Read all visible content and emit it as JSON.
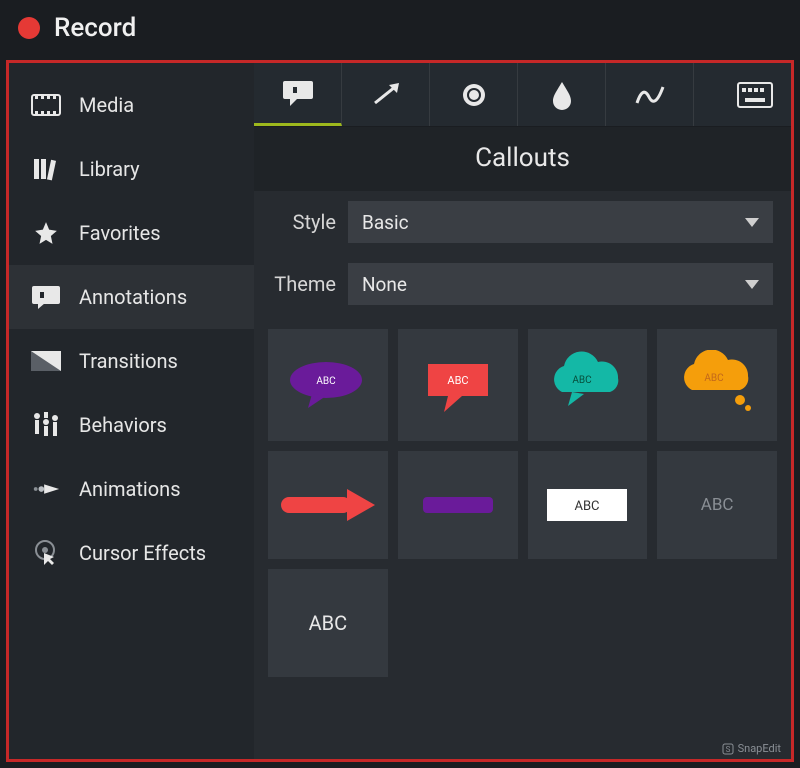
{
  "topbar": {
    "record_label": "Record"
  },
  "sidebar": {
    "items": [
      {
        "label": "Media"
      },
      {
        "label": "Library"
      },
      {
        "label": "Favorites"
      },
      {
        "label": "Annotations"
      },
      {
        "label": "Transitions"
      },
      {
        "label": "Behaviors"
      },
      {
        "label": "Animations"
      },
      {
        "label": "Cursor Effects"
      }
    ],
    "active_index": 3
  },
  "tabs": {
    "items": [
      "callout",
      "arrow",
      "shape",
      "blur",
      "sketch",
      "keyboard"
    ],
    "active_index": 0
  },
  "panel": {
    "title": "Callouts",
    "style_label": "Style",
    "style_value": "Basic",
    "theme_label": "Theme",
    "theme_value": "None"
  },
  "callout_tiles": [
    {
      "kind": "speech-oval",
      "color": "#6a1b9a",
      "text": "ABC"
    },
    {
      "kind": "speech-rect",
      "color": "#ef4444",
      "text": "ABC"
    },
    {
      "kind": "cloud",
      "color": "#14b8a6",
      "text": "ABC"
    },
    {
      "kind": "thought-cloud",
      "color": "#f59e0b",
      "text": "ABC"
    },
    {
      "kind": "arrow-right",
      "color": "#ef4444",
      "text": ""
    },
    {
      "kind": "bar",
      "color": "#6a1b9a",
      "text": ""
    },
    {
      "kind": "rect-label",
      "color": "#ffffff",
      "text": "ABC",
      "text_color": "#333"
    },
    {
      "kind": "text-only",
      "color": "",
      "text": "ABC",
      "text_color": "#8a8f95"
    },
    {
      "kind": "text-only",
      "color": "",
      "text": "ABC",
      "text_color": "#e8e8e8"
    }
  ],
  "watermark": "SnapEdit"
}
